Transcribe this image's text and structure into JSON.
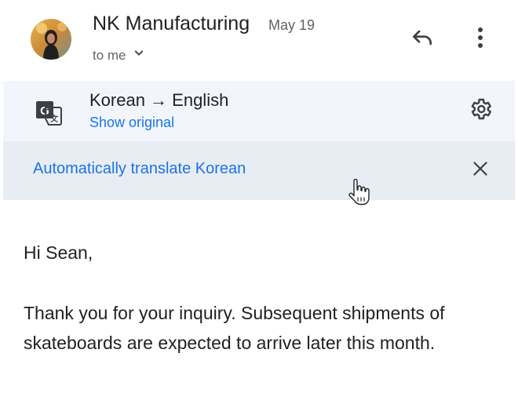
{
  "header": {
    "sender": "NK Manufacturing",
    "date": "May 19",
    "recipient": "to me",
    "icons": {
      "avatar": "avatar",
      "recipient_toggle": "chevron-down-icon",
      "reply": "reply-icon",
      "more": "more-vert-icon"
    }
  },
  "translation": {
    "languages": "Korean → English",
    "show_original": "Show original",
    "auto_translate": "Automatically translate Korean",
    "icons": {
      "translate": "translate-icon",
      "settings": "gear-icon",
      "close": "close-icon"
    }
  },
  "body": {
    "greeting": "Hi Sean,",
    "message": "Thank you for your inquiry. Subsequent shipments of skateboards are expected to arrive later this month."
  },
  "colors": {
    "link": "#1a73e8",
    "translate_bar_bg": "#f2f6fc",
    "auto_bar_bg": "#e8edf3",
    "text": "#202124",
    "secondary_text": "#5f6368"
  }
}
